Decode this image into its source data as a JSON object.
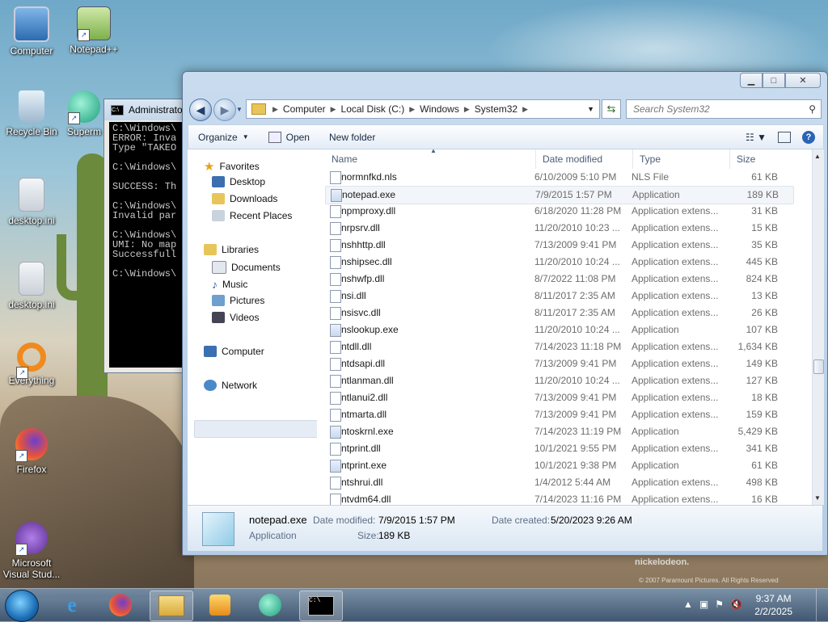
{
  "desktop": {
    "icons": [
      {
        "label": "Computer"
      },
      {
        "label": "Notepad++"
      },
      {
        "label": "Recycle Bin"
      },
      {
        "label": "Superm"
      },
      {
        "label": "desktop.ini"
      },
      {
        "label": "desktop.ini"
      },
      {
        "label": "Everything"
      },
      {
        "label": "Firefox"
      },
      {
        "label": "Microsoft Visual Stud..."
      }
    ],
    "watermark": "nickelodeon.",
    "watermark_small": "© 2007 Paramount Pictures. All Rights Reserved"
  },
  "cmd": {
    "title": "Administrator",
    "lines": "C:\\Windows\\\nERROR: Inva\nType \"TAKEO\n\nC:\\Windows\\\n\nSUCCESS: Th\n\nC:\\Windows\\\nInvalid par\n\nC:\\Windows\\\nUMI: No map\nSuccessfull\n\nC:\\Windows\\"
  },
  "explorer": {
    "address": [
      "Computer",
      "Local Disk (C:)",
      "Windows",
      "System32"
    ],
    "search_placeholder": "Search System32",
    "toolbar": {
      "organize": "Organize",
      "open": "Open",
      "new_folder": "New folder"
    },
    "nav": {
      "favorites": "Favorites",
      "desktop": "Desktop",
      "downloads": "Downloads",
      "recent": "Recent Places",
      "libraries": "Libraries",
      "documents": "Documents",
      "music": "Music",
      "pictures": "Pictures",
      "videos": "Videos",
      "computer": "Computer",
      "network": "Network"
    },
    "columns": {
      "name": "Name",
      "date": "Date modified",
      "type": "Type",
      "size": "Size"
    },
    "files": [
      {
        "name": "normnfkd.nls",
        "date": "6/10/2009 5:10 PM",
        "type": "NLS File",
        "size": "61 KB"
      },
      {
        "name": "notepad.exe",
        "date": "7/9/2015 1:57 PM",
        "type": "Application",
        "size": "189 KB"
      },
      {
        "name": "npmproxy.dll",
        "date": "6/18/2020 11:28 PM",
        "type": "Application extens...",
        "size": "31 KB"
      },
      {
        "name": "nrpsrv.dll",
        "date": "11/20/2010 10:23 ...",
        "type": "Application extens...",
        "size": "15 KB"
      },
      {
        "name": "nshhttp.dll",
        "date": "7/13/2009 9:41 PM",
        "type": "Application extens...",
        "size": "35 KB"
      },
      {
        "name": "nshipsec.dll",
        "date": "11/20/2010 10:24 ...",
        "type": "Application extens...",
        "size": "445 KB"
      },
      {
        "name": "nshwfp.dll",
        "date": "8/7/2022 11:08 PM",
        "type": "Application extens...",
        "size": "824 KB"
      },
      {
        "name": "nsi.dll",
        "date": "8/11/2017 2:35 AM",
        "type": "Application extens...",
        "size": "13 KB"
      },
      {
        "name": "nsisvc.dll",
        "date": "8/11/2017 2:35 AM",
        "type": "Application extens...",
        "size": "26 KB"
      },
      {
        "name": "nslookup.exe",
        "date": "11/20/2010 10:24 ...",
        "type": "Application",
        "size": "107 KB"
      },
      {
        "name": "ntdll.dll",
        "date": "7/14/2023 11:18 PM",
        "type": "Application extens...",
        "size": "1,634 KB"
      },
      {
        "name": "ntdsapi.dll",
        "date": "7/13/2009 9:41 PM",
        "type": "Application extens...",
        "size": "149 KB"
      },
      {
        "name": "ntlanman.dll",
        "date": "11/20/2010 10:24 ...",
        "type": "Application extens...",
        "size": "127 KB"
      },
      {
        "name": "ntlanui2.dll",
        "date": "7/13/2009 9:41 PM",
        "type": "Application extens...",
        "size": "18 KB"
      },
      {
        "name": "ntmarta.dll",
        "date": "7/13/2009 9:41 PM",
        "type": "Application extens...",
        "size": "159 KB"
      },
      {
        "name": "ntoskrnl.exe",
        "date": "7/14/2023 11:19 PM",
        "type": "Application",
        "size": "5,429 KB"
      },
      {
        "name": "ntprint.dll",
        "date": "10/1/2021 9:55 PM",
        "type": "Application extens...",
        "size": "341 KB"
      },
      {
        "name": "ntprint.exe",
        "date": "10/1/2021 9:38 PM",
        "type": "Application",
        "size": "61 KB"
      },
      {
        "name": "ntshrui.dll",
        "date": "1/4/2012 5:44 AM",
        "type": "Application extens...",
        "size": "498 KB"
      },
      {
        "name": "ntvdm64.dll",
        "date": "7/14/2023 11:16 PM",
        "type": "Application extens...",
        "size": "16 KB"
      }
    ],
    "details": {
      "name": "notepad.exe",
      "type": "Application",
      "date_modified_label": "Date modified:",
      "date_modified": "7/9/2015 1:57 PM",
      "size_label": "Size:",
      "size": "189 KB",
      "date_created_label": "Date created:",
      "date_created": "5/20/2023 9:26 AM"
    }
  },
  "taskbar": {
    "time": "9:37 AM",
    "date": "2/2/2025"
  }
}
